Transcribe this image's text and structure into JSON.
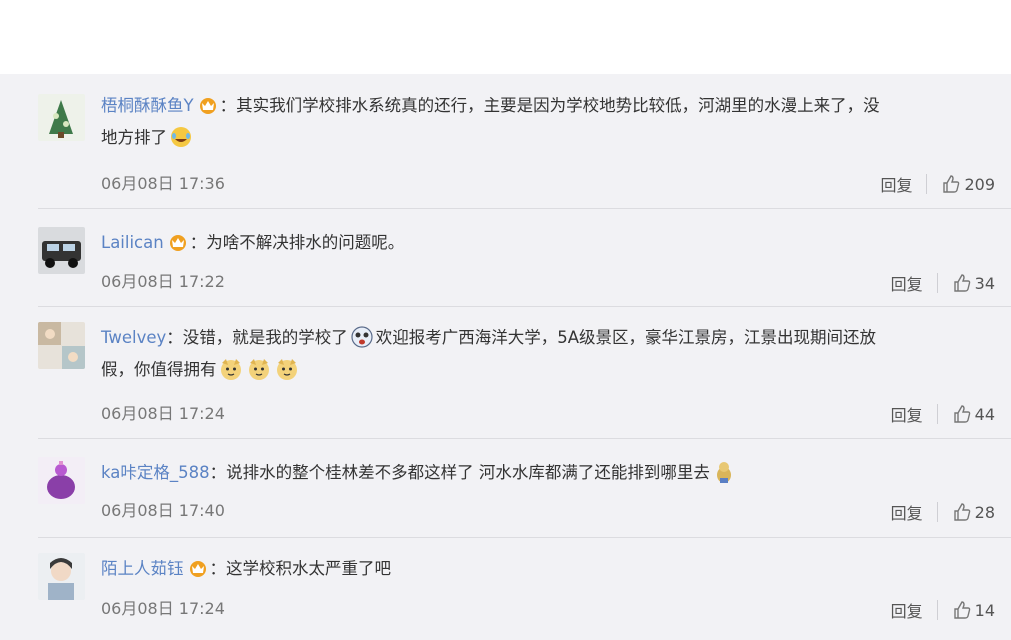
{
  "comments": [
    {
      "user": "梧桐酥酥鱼Y",
      "text1": "：其实我们学校排水系统真的还行，主要是因为学校地势比较低，河湖里的水漫上来了，没",
      "text2": "地方排了",
      "time": "06月08日 17:36",
      "reply": "回复",
      "likes": "209",
      "emoji": [
        "crying-laugh-emoji"
      ]
    },
    {
      "user": "Lailican",
      "text1": "：为啥不解决排水的问题呢。",
      "time": "06月08日 17:22",
      "reply": "回复",
      "likes": "34"
    },
    {
      "user": "Twelvey",
      "text1a": "：没错，就是我的学校了",
      "text1b": "欢迎报考广西海洋大学，5A级景区，豪华江景房，江景出现期间还放",
      "text2": "假，你值得拥有",
      "time": "06月08日 17:24",
      "reply": "回复",
      "likes": "44",
      "emoji": [
        "crazy-emoji",
        "doge-emoji",
        "doge-emoji",
        "doge-emoji"
      ]
    },
    {
      "user": "ka咔定格_588",
      "text1": "：说排水的整个桂林差不多都这样了 河水水库都满了还能排到哪里去",
      "time": "06月08日 17:40",
      "reply": "回复",
      "likes": "28",
      "emoji": [
        "bear-emoji"
      ]
    },
    {
      "user": "陌上人茹钰",
      "text1": "：这学校积水太严重了吧",
      "time": "06月08日 17:24",
      "reply": "回复",
      "likes": "14"
    }
  ],
  "colors": {
    "username": "#5b83c4",
    "background": "#f2f2f5",
    "crown": "#f0a020"
  }
}
